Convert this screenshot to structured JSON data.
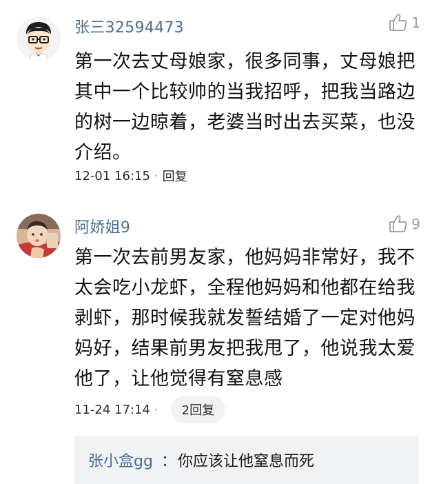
{
  "comments": [
    {
      "username": "张三32594473",
      "like_count": "1",
      "text": "第一次去丈母娘家，很多同事，丈母娘把其中一个比较帅的当我招呼，把我当路边的树一边晾着，老婆当时出去买菜，也没介绍。",
      "timestamp": "12-01 16:15",
      "separator": "·",
      "reply_label": "回复"
    },
    {
      "username": "阿娇姐9",
      "like_count": "9",
      "text": "第一次去前男友家，他妈妈非常好，我不太会吃小龙虾，全程他妈妈和他都在给我剥虾，那时候我就发誓结婚了一定对他妈妈好，结果前男友把我甩了，他说我太爱他了，让他觉得有窒息感",
      "timestamp": "11-24 17:14",
      "separator": "·",
      "reply_label": "2回复",
      "subreply": {
        "username": "张小盒gg",
        "separator": "：",
        "text": "你应该让他窒息而死"
      }
    }
  ],
  "colors": {
    "username": "#4a6d94",
    "body_text": "#111111",
    "meta_text": "#2b2b2b",
    "like_icon": "#9a9a9a",
    "pill_bg": "#f1f2f4"
  },
  "icons": [
    "thumbs-up-icon",
    "cartoon-avatar",
    "photo-avatar"
  ]
}
